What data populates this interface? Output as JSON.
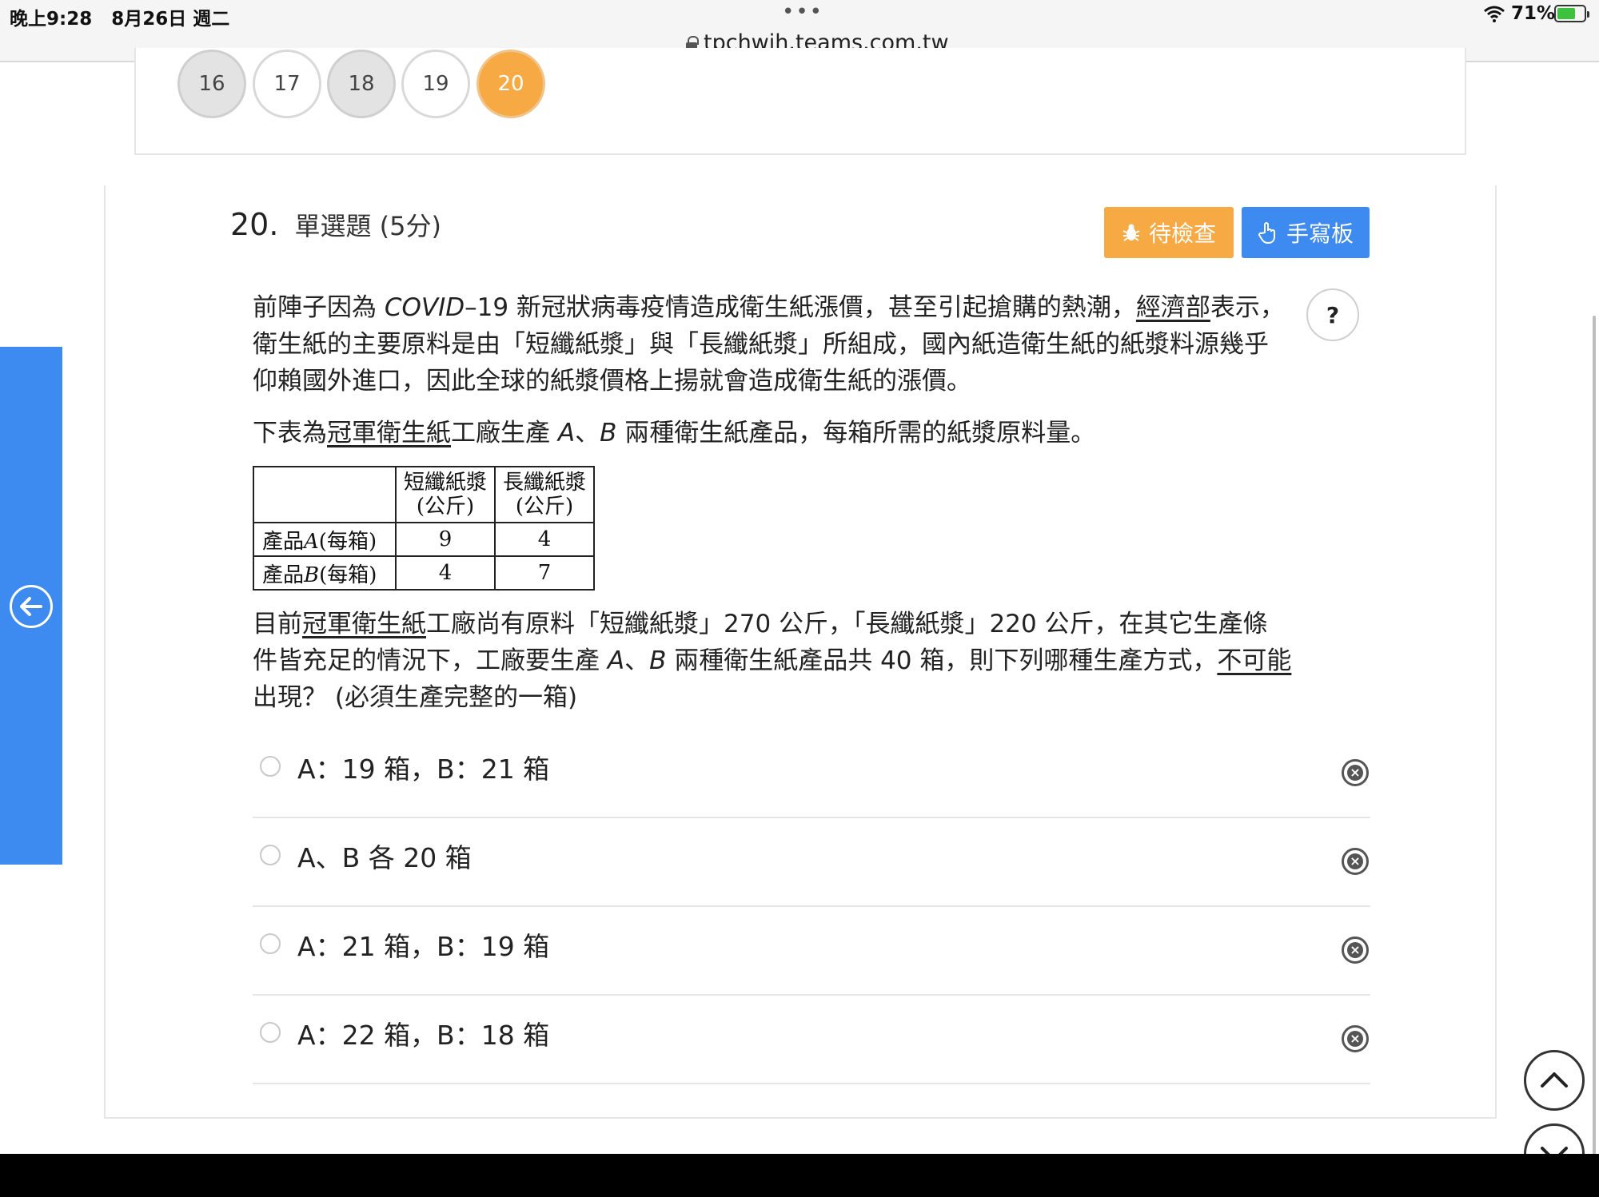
{
  "status_bar": {
    "time": "晚上9:28",
    "date": "8月26日 週二",
    "url": "tpchwjh.teams.com.tw",
    "battery": "71%"
  },
  "question_nav": [
    {
      "label": "16",
      "state": "answered"
    },
    {
      "label": "17",
      "state": "unanswered"
    },
    {
      "label": "18",
      "state": "answered"
    },
    {
      "label": "19",
      "state": "unanswered"
    },
    {
      "label": "20",
      "state": "current"
    }
  ],
  "question": {
    "number": "20.",
    "type": "單選題 (5分)",
    "check_button": "待檢查",
    "handwriting_button": "手寫板",
    "help": "?",
    "para1_a": "前陣子因為 ",
    "para1_covid": "COVID",
    "para1_b": "–19 新冠狀病毒疫情造成衛生紙漲價，甚至引起搶購的熱潮，",
    "para1_ministry": "經濟部",
    "para1_c": "表示，衛生紙的主要原料是由「短纖紙漿」與「長纖紙漿」所組成，國內紙造衛生紙的紙漿料源幾乎仰賴國外進口，因此全球的紙漿價格上揚就會造成衛生紙的漲價。",
    "para2_a": "下表為",
    "para2_company": "冠軍衛生紙",
    "para2_b": "工廠生產 ",
    "para2_A": "A",
    "para2_c": "、",
    "para2_B": "B",
    "para2_d": " 兩種衛生紙產品，每箱所需的紙漿原料量。",
    "para3_a": "目前",
    "para3_company": "冠軍衛生紙",
    "para3_b": "工廠尚有原料「短纖紙漿」270 公斤，「長纖紙漿」220 公斤，在其它生產條件皆充足的情況下，工廠要生產 ",
    "para3_A": "A",
    "para3_c": "、",
    "para3_B": "B",
    "para3_d": " 兩種衛生紙產品共 40 箱，則下列哪種生產方式，",
    "para3_neg": "不可能",
    "para3_e": "出現？ (必須生產完整的一箱)"
  },
  "table": {
    "col1_line1": "短纖紙漿",
    "col1_line2": "(公斤)",
    "col2_line1": "長纖紙漿",
    "col2_line2": "(公斤)",
    "rows": [
      {
        "label_a": "產品",
        "product": "A",
        "label_b": "(每箱)",
        "short": "9",
        "long": "4"
      },
      {
        "label_a": "產品",
        "product": "B",
        "label_b": "(每箱)",
        "short": "4",
        "long": "7"
      }
    ]
  },
  "options": [
    {
      "text": "A：19 箱，B：21 箱"
    },
    {
      "text": "A、B 各 20 箱"
    },
    {
      "text": "A：21 箱，B：19 箱"
    },
    {
      "text": "A：22 箱，B：18 箱"
    }
  ],
  "colors": {
    "accent_orange": "#f7a944",
    "accent_blue": "#3d8bf0"
  }
}
